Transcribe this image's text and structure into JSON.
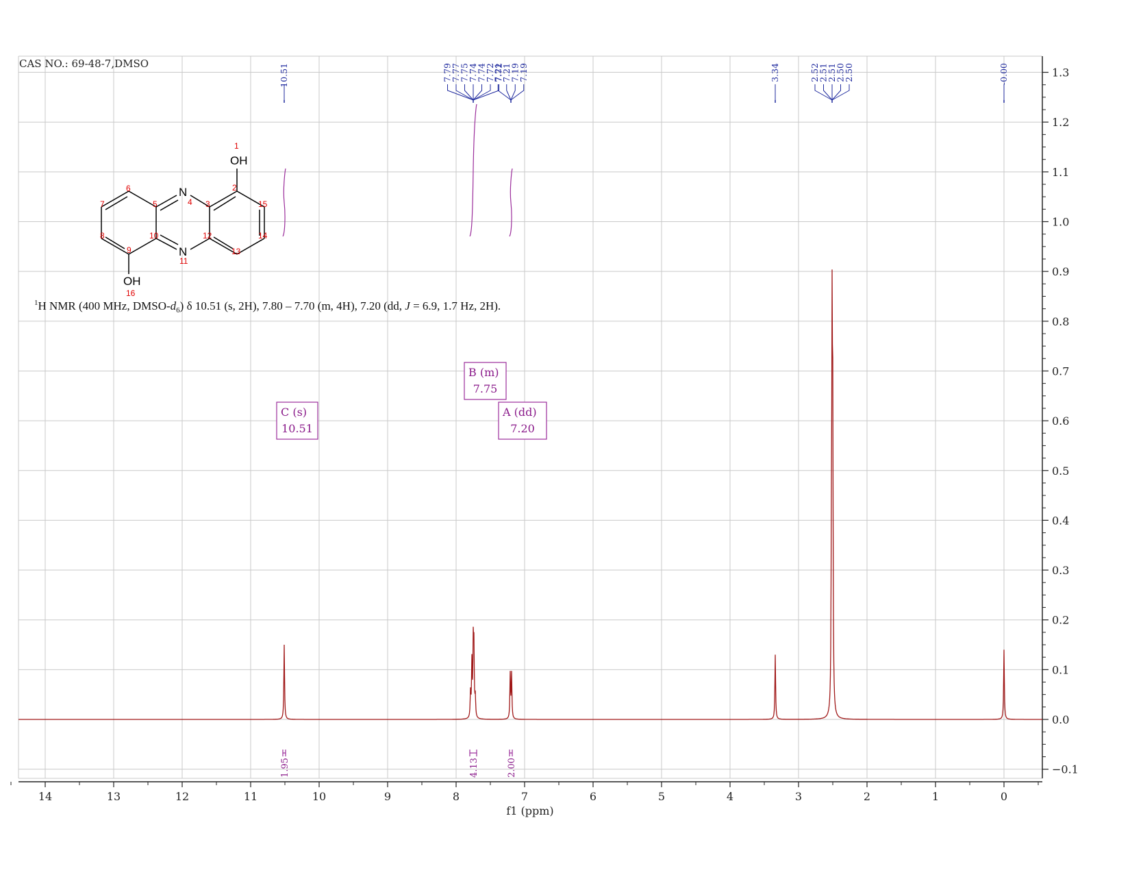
{
  "header": {
    "cas_text": "CAS NO.: 69-48-7,DMSO"
  },
  "summary": {
    "sup": "1",
    "nmr": "H NMR (400 MHz, DMSO-",
    "d": "d",
    "sub": "6",
    "rest1": ") δ 10.51 (s, 2H), 7.80 – 7.70 (m, 4H), 7.20 (dd, ",
    "J": "J",
    "rest2": " = 6.9, 1.7 Hz, 2H)."
  },
  "structure": {
    "atoms": [
      "OH",
      "N",
      "N",
      "OH"
    ],
    "numbers": [
      "1",
      "2",
      "3",
      "4",
      "5",
      "6",
      "7",
      "8",
      "9",
      "10",
      "11",
      "12",
      "13",
      "14",
      "15",
      "16"
    ]
  },
  "colors": {
    "spectrum": "#a01818",
    "integral": "#9b2d9b",
    "peak_label": "#1f2a9e",
    "grid": "#c9c9c9",
    "axis": "#222222"
  },
  "chart_data": {
    "type": "line",
    "title": "",
    "xlabel": "f1 (ppm)",
    "ylabel": "",
    "xlim": [
      14.5,
      -0.5
    ],
    "ylim": [
      -0.12,
      1.32
    ],
    "x_reversed": true,
    "grid": true,
    "x_ticks": [
      "14",
      "13",
      "12",
      "11",
      "10",
      "9",
      "8",
      "7",
      "6",
      "5",
      "4",
      "3",
      "2",
      "1",
      "0"
    ],
    "y_ticks": [
      "1.3",
      "1.2",
      "1.1",
      "1.0",
      "0.9",
      "0.8",
      "0.7",
      "0.6",
      "0.5",
      "0.4",
      "0.3",
      "0.2",
      "0.1",
      "0.0",
      "−0.1"
    ],
    "peaks": [
      {
        "ppm": 10.51,
        "height": 0.15
      },
      {
        "ppm": 7.79,
        "height": 0.05
      },
      {
        "ppm": 7.77,
        "height": 0.11
      },
      {
        "ppm": 7.75,
        "height": 0.14
      },
      {
        "ppm": 7.74,
        "height": 0.13
      },
      {
        "ppm": 7.72,
        "height": 0.04
      },
      {
        "ppm": 7.21,
        "height": 0.09
      },
      {
        "ppm": 7.19,
        "height": 0.09
      },
      {
        "ppm": 3.34,
        "height": 0.13
      },
      {
        "ppm": 2.52,
        "height": 0.25
      },
      {
        "ppm": 2.51,
        "height": 0.7
      },
      {
        "ppm": 2.5,
        "height": 0.52
      },
      {
        "ppm": 0.0,
        "height": 0.14
      }
    ],
    "peak_labels": [
      {
        "group": "g1",
        "ppm": 10.51,
        "texts": [
          "10.51"
        ]
      },
      {
        "group": "g2",
        "ppm": 7.75,
        "texts": [
          "7.79",
          "7.77",
          "7.75",
          "7.74",
          "7.74",
          "7.72",
          "7.72"
        ]
      },
      {
        "group": "g3",
        "ppm": 7.2,
        "texts": [
          "7.21",
          "7.21",
          "7.19",
          "7.19"
        ]
      },
      {
        "group": "g4",
        "ppm": 3.34,
        "texts": [
          "3.34"
        ]
      },
      {
        "group": "g5",
        "ppm": 2.51,
        "texts": [
          "2.52",
          "2.51",
          "2.51",
          "2.50",
          "2.50"
        ]
      },
      {
        "group": "g6",
        "ppm": 0.0,
        "texts": [
          "-0.00"
        ]
      }
    ],
    "multiplets": [
      {
        "ppm": 10.51,
        "line1": "C (s)",
        "line2": "10.51"
      },
      {
        "ppm": 7.75,
        "line1": "B (m)",
        "line2": "7.75"
      },
      {
        "ppm": 7.2,
        "line1": "A (dd)",
        "line2": "7.20"
      }
    ],
    "integrals": [
      {
        "from": 10.53,
        "to": 10.49,
        "value": "1.95"
      },
      {
        "from": 7.8,
        "to": 7.7,
        "value": "4.13"
      },
      {
        "from": 7.22,
        "to": 7.18,
        "value": "2.00"
      }
    ]
  }
}
